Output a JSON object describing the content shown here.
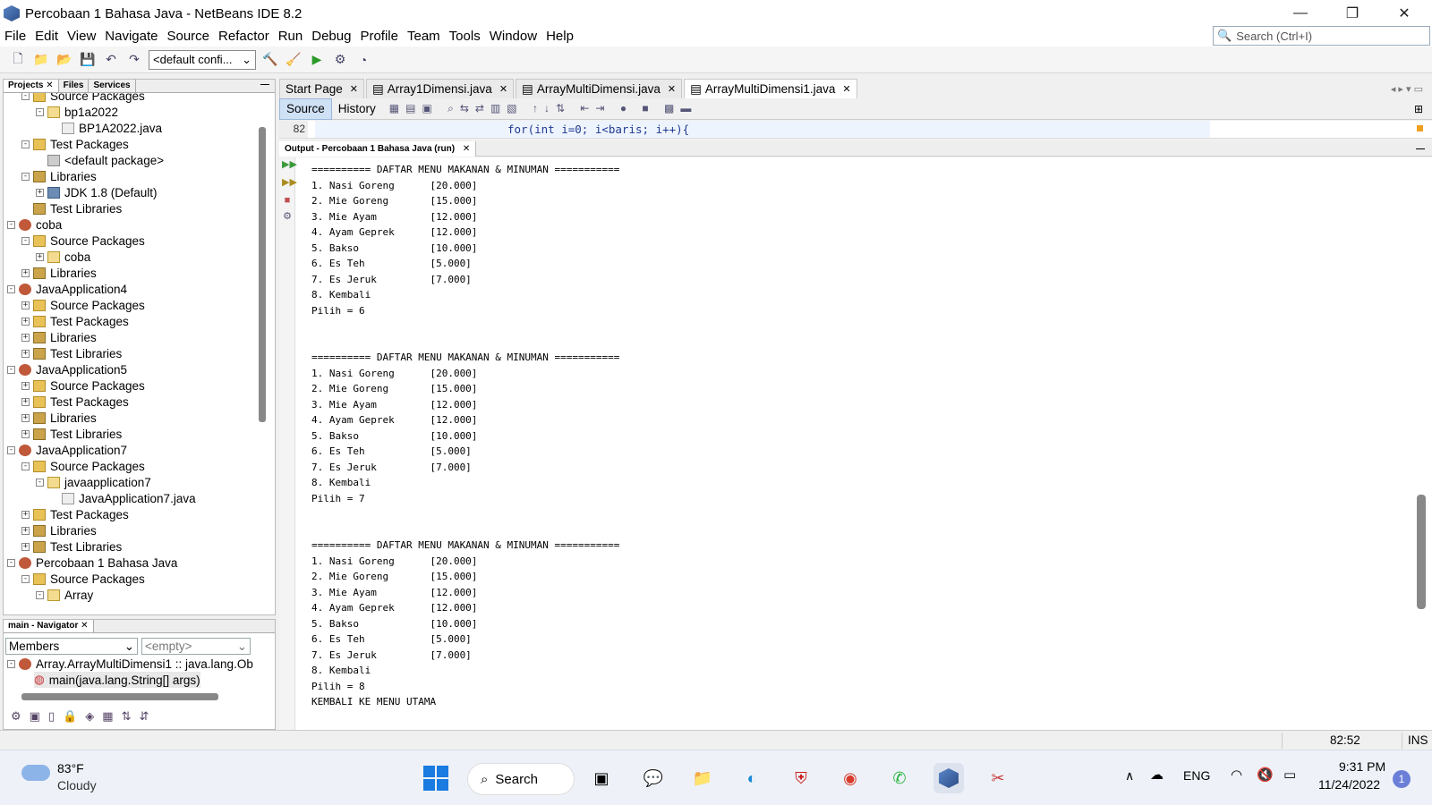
{
  "window": {
    "title": "Percobaan 1 Bahasa Java - NetBeans IDE 8.2"
  },
  "menu": [
    "File",
    "Edit",
    "View",
    "Navigate",
    "Source",
    "Refactor",
    "Run",
    "Debug",
    "Profile",
    "Team",
    "Tools",
    "Window",
    "Help"
  ],
  "search": {
    "placeholder": "Search (Ctrl+I)"
  },
  "toolbar": {
    "config": "<default confi..."
  },
  "left_tabs": [
    "Projects",
    "Files",
    "Services"
  ],
  "tree": [
    {
      "label": "Source Packages",
      "level": 1,
      "icon": "pkgf",
      "tog": "-"
    },
    {
      "label": "bp1a2022",
      "level": 2,
      "icon": "pkg",
      "tog": "-"
    },
    {
      "label": "BP1A2022.java",
      "level": 3,
      "icon": "java",
      "tog": ""
    },
    {
      "label": "Test Packages",
      "level": 1,
      "icon": "pkgf",
      "tog": "-"
    },
    {
      "label": "<default package>",
      "level": 2,
      "icon": "dpk",
      "tog": ""
    },
    {
      "label": "Libraries",
      "level": 1,
      "icon": "lib",
      "tog": "-"
    },
    {
      "label": "JDK 1.8 (Default)",
      "level": 2,
      "icon": "jdk",
      "tog": "+"
    },
    {
      "label": "Test Libraries",
      "level": 1,
      "icon": "lib",
      "tog": ""
    },
    {
      "label": "coba",
      "level": 0,
      "icon": "proj",
      "tog": "-"
    },
    {
      "label": "Source Packages",
      "level": 1,
      "icon": "pkgf",
      "tog": "-"
    },
    {
      "label": "coba",
      "level": 2,
      "icon": "pkg",
      "tog": "+"
    },
    {
      "label": "Libraries",
      "level": 1,
      "icon": "lib",
      "tog": "+"
    },
    {
      "label": "JavaApplication4",
      "level": 0,
      "icon": "proj",
      "tog": "-"
    },
    {
      "label": "Source Packages",
      "level": 1,
      "icon": "pkgf",
      "tog": "+"
    },
    {
      "label": "Test Packages",
      "level": 1,
      "icon": "pkgf",
      "tog": "+"
    },
    {
      "label": "Libraries",
      "level": 1,
      "icon": "lib",
      "tog": "+"
    },
    {
      "label": "Test Libraries",
      "level": 1,
      "icon": "lib",
      "tog": "+"
    },
    {
      "label": "JavaApplication5",
      "level": 0,
      "icon": "proj",
      "tog": "-"
    },
    {
      "label": "Source Packages",
      "level": 1,
      "icon": "pkgf",
      "tog": "+"
    },
    {
      "label": "Test Packages",
      "level": 1,
      "icon": "pkgf",
      "tog": "+"
    },
    {
      "label": "Libraries",
      "level": 1,
      "icon": "lib",
      "tog": "+"
    },
    {
      "label": "Test Libraries",
      "level": 1,
      "icon": "lib",
      "tog": "+"
    },
    {
      "label": "JavaApplication7",
      "level": 0,
      "icon": "proj",
      "tog": "-"
    },
    {
      "label": "Source Packages",
      "level": 1,
      "icon": "pkgf",
      "tog": "-"
    },
    {
      "label": "javaapplication7",
      "level": 2,
      "icon": "pkg",
      "tog": "-"
    },
    {
      "label": "JavaApplication7.java",
      "level": 3,
      "icon": "java",
      "tog": ""
    },
    {
      "label": "Test Packages",
      "level": 1,
      "icon": "pkgf",
      "tog": "+"
    },
    {
      "label": "Libraries",
      "level": 1,
      "icon": "lib",
      "tog": "+"
    },
    {
      "label": "Test Libraries",
      "level": 1,
      "icon": "lib",
      "tog": "+"
    },
    {
      "label": "Percobaan 1 Bahasa Java",
      "level": 0,
      "icon": "proj",
      "tog": "-"
    },
    {
      "label": "Source Packages",
      "level": 1,
      "icon": "pkgf",
      "tog": "-"
    },
    {
      "label": "Array",
      "level": 2,
      "icon": "pkg",
      "tog": "-"
    }
  ],
  "navigator": {
    "tab": "main - Navigator",
    "members": "Members",
    "filter": "<empty>",
    "class_node": "Array.ArrayMultiDimensi1 :: java.lang.Ob",
    "method_node": "main(java.lang.String[] args)"
  },
  "editor_tabs": [
    {
      "label": "Start Page"
    },
    {
      "label": "Array1Dimensi.java"
    },
    {
      "label": "ArrayMultiDimensi.java"
    },
    {
      "label": "ArrayMultiDimensi1.java"
    }
  ],
  "source_view": {
    "source": "Source",
    "history": "History"
  },
  "code": {
    "line_no": "82",
    "text": "for(int i=0; i<baris; i++){"
  },
  "output": {
    "tab": "Output - Percobaan 1 Bahasa Java (run)",
    "lines": [
      "========== DAFTAR MENU MAKANAN & MINUMAN ===========",
      "1. Nasi Goreng      [20.000]",
      "2. Mie Goreng       [15.000]",
      "3. Mie Ayam         [12.000]",
      "4. Ayam Geprek      [12.000]",
      "5. Bakso            [10.000]",
      "6. Es Teh           [5.000]",
      "7. Es Jeruk         [7.000]",
      "8. Kembali",
      "Pilih = 6",
      "",
      "",
      "========== DAFTAR MENU MAKANAN & MINUMAN ===========",
      "1. Nasi Goreng      [20.000]",
      "2. Mie Goreng       [15.000]",
      "3. Mie Ayam         [12.000]",
      "4. Ayam Geprek      [12.000]",
      "5. Bakso            [10.000]",
      "6. Es Teh           [5.000]",
      "7. Es Jeruk         [7.000]",
      "8. Kembali",
      "Pilih = 7",
      "",
      "",
      "========== DAFTAR MENU MAKANAN & MINUMAN ===========",
      "1. Nasi Goreng      [20.000]",
      "2. Mie Goreng       [15.000]",
      "3. Mie Ayam         [12.000]",
      "4. Ayam Geprek      [12.000]",
      "5. Bakso            [10.000]",
      "6. Es Teh           [5.000]",
      "7. Es Jeruk         [7.000]",
      "8. Kembali",
      "Pilih = 8",
      "KEMBALI KE MENU UTAMA"
    ]
  },
  "status": {
    "position": "82:52",
    "mode": "INS"
  },
  "taskbar": {
    "weather_temp": "83°F",
    "weather_desc": "Cloudy",
    "search": "Search",
    "lang": "ENG",
    "time": "9:31 PM",
    "date": "11/24/2022",
    "notif": "1"
  },
  "colors": {
    "accent": "#2c5aa0",
    "output_green": "#3a9a3a"
  }
}
